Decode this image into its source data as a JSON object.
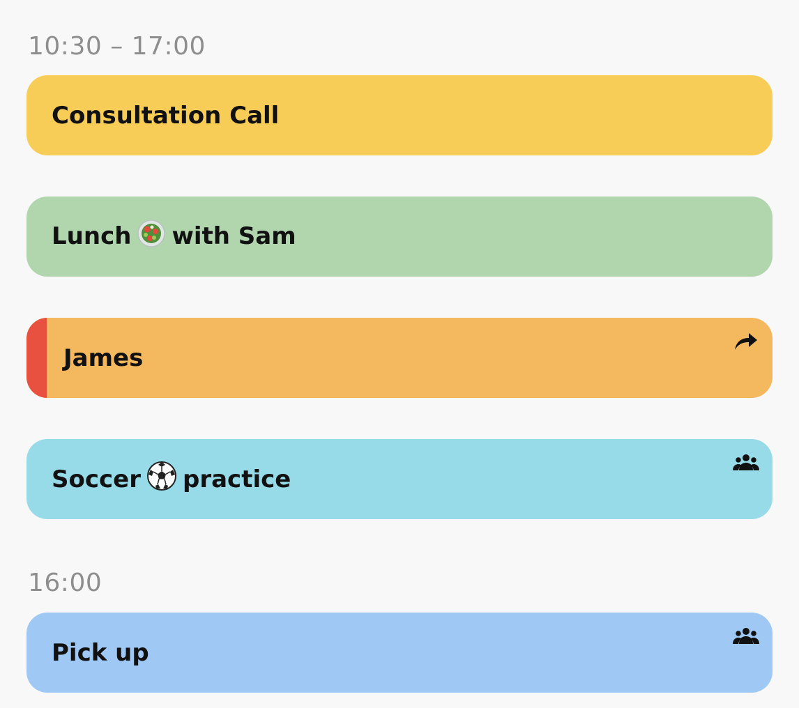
{
  "sections": [
    {
      "time": "10:30 – 17:00"
    },
    {
      "time": "16:00"
    }
  ],
  "events": [
    {
      "title": "Consultation Call",
      "color": "#f7cd58"
    },
    {
      "title_before": "Lunch",
      "emoji": "salad-icon",
      "title_after": "with Sam",
      "color": "#b1d6ae"
    },
    {
      "title": "James",
      "color": "#f4b85e",
      "stripe_color": "#e8513f",
      "icon": "share-arrow-icon"
    },
    {
      "title_before": "Soccer",
      "emoji": "soccer-ball-icon",
      "title_after": "practice",
      "color": "#97dbe8",
      "icon": "group-icon"
    },
    {
      "title": "Pick up",
      "color": "#9fc8f4",
      "icon": "group-icon"
    }
  ]
}
